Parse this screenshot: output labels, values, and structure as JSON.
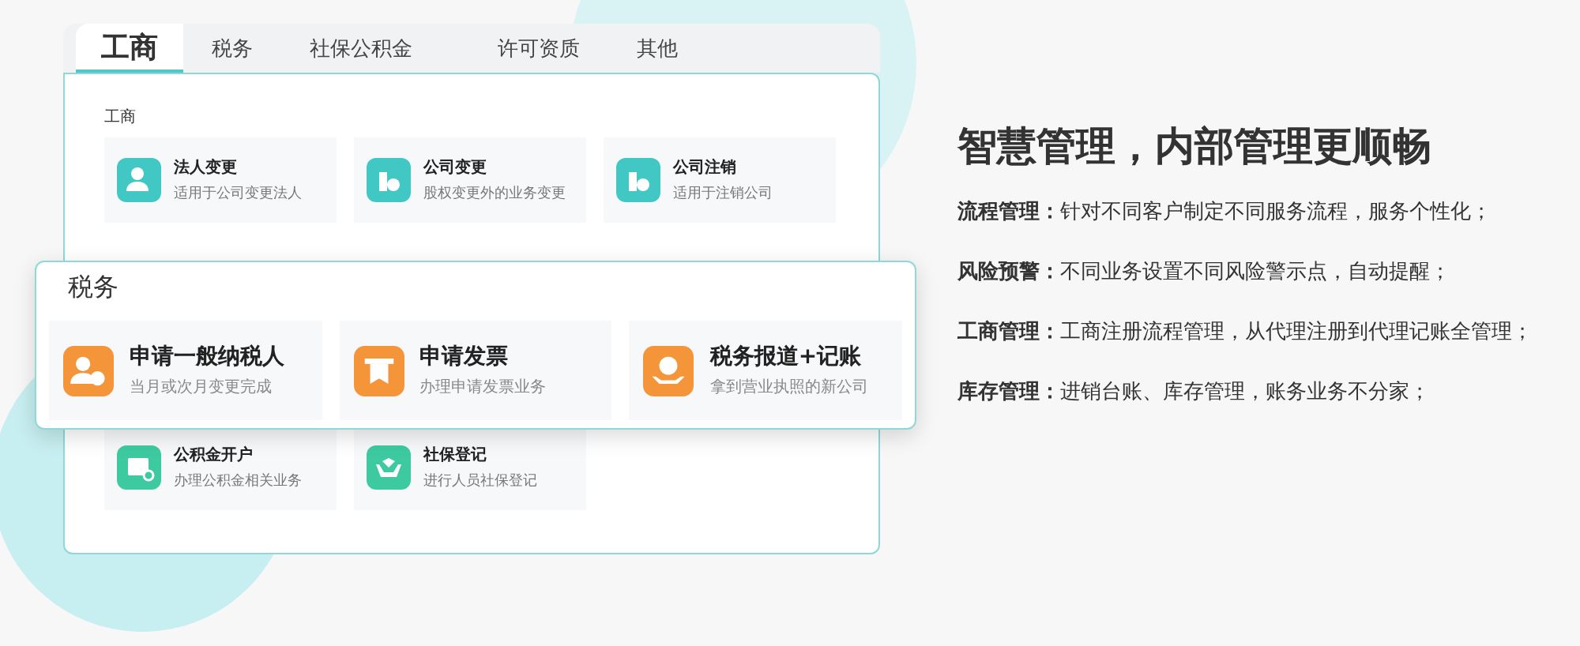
{
  "tabs": [
    {
      "label": "工商",
      "selected": true
    },
    {
      "label": "税务",
      "selected": false
    },
    {
      "label": "社保公积金",
      "selected": false
    },
    {
      "label": "许可资质",
      "selected": false
    },
    {
      "label": "其他",
      "selected": false
    }
  ],
  "sections": [
    {
      "title": "工商",
      "cards": [
        {
          "title": "法人变更",
          "desc": "适用于公司变更法人",
          "kind": "person",
          "color": "#41c7c4"
        },
        {
          "title": "公司变更",
          "desc": "股权变更外的业务变更",
          "kind": "building",
          "color": "#41c7c4"
        },
        {
          "title": "公司注销",
          "desc": "适用于注销公司",
          "kind": "building",
          "color": "#41c7c4"
        }
      ]
    },
    {
      "cards": [
        {
          "title": "公积金开户",
          "desc": "办理公积金相关业务",
          "kind": "card",
          "color": "#3ecaa0"
        },
        {
          "title": "社保登记",
          "desc": "进行人员社保登记",
          "kind": "hands",
          "color": "#3ecaa0"
        }
      ]
    }
  ],
  "popup": {
    "title": "税务",
    "cards": [
      {
        "title": "申请一般纳税人",
        "desc": "当月或次月变更完成",
        "kind": "person",
        "color": "#f5953a"
      },
      {
        "title": "申请发票",
        "desc": "办理申请发票业务",
        "kind": "receipt",
        "color": "#f5953a"
      },
      {
        "title": "税务报道+记账",
        "desc": "拿到营业执照的新公司",
        "kind": "hands",
        "color": "#f5953a"
      }
    ]
  },
  "headline": "智慧管理，内部管理更顺畅",
  "features": [
    {
      "term": "流程管理：",
      "text": "针对不同客户制定不同服务流程，服务个性化；"
    },
    {
      "term": "风险预警：",
      "text": "不同业务设置不同风险警示点，自动提醒；"
    },
    {
      "term": "工商管理：",
      "text": "工商注册流程管理，从代理注册到代理记账全管理；"
    },
    {
      "term": "库存管理：",
      "text": "进销台账、库存管理，账务业务不分家；"
    }
  ]
}
